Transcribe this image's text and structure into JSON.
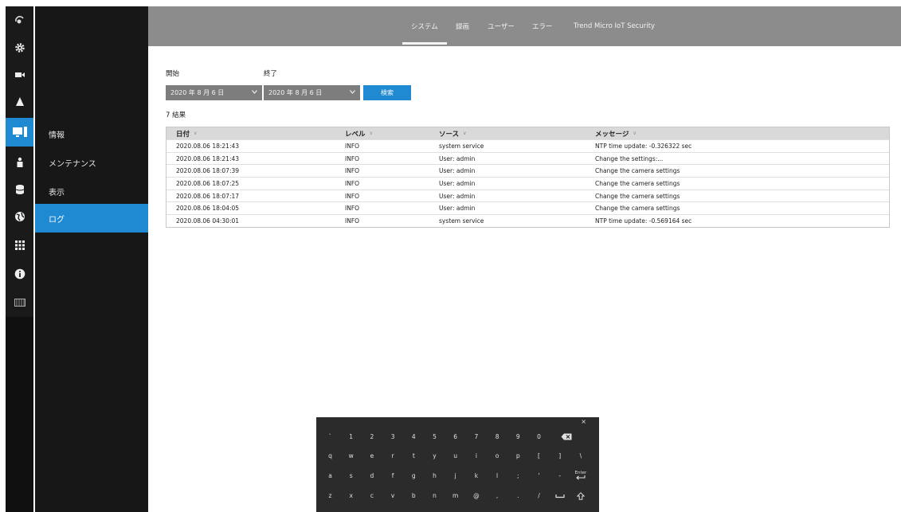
{
  "topbar": {
    "tabs": [
      {
        "label": "システム",
        "active": true
      },
      {
        "label": "録画",
        "active": false
      },
      {
        "label": "ユーザー",
        "active": false
      },
      {
        "label": "エラー",
        "active": false
      },
      {
        "label": "Trend Micro IoT Security",
        "active": false
      }
    ]
  },
  "sidebar": {
    "icons": [
      "camera-eye-icon",
      "gear-icon",
      "video-camera-icon",
      "bell-icon",
      "monitor-icon",
      "person-icon",
      "database-icon",
      "globe-icon",
      "grid-icon",
      "info-icon",
      "film-icon"
    ],
    "items": [
      {
        "label": "情報"
      },
      {
        "label": "メンテナンス"
      },
      {
        "label": "表示"
      },
      {
        "label": "ログ",
        "active": true
      }
    ]
  },
  "filter": {
    "start_label": "開始",
    "end_label": "終了",
    "start_date": "2020 年 8 月 6 日",
    "end_date": "2020 年 8 月 6 日",
    "search_label": "検索"
  },
  "results": "7 結果",
  "table": {
    "columns": [
      "日付",
      "レベル",
      "ソース",
      "メッセージ"
    ],
    "rows": [
      [
        "2020.08.06 18:21:43",
        "INFO",
        "system service",
        "NTP time update: -0.326322 sec"
      ],
      [
        "2020.08.06 18:21:43",
        "INFO",
        "User: admin",
        "Change the settings:..."
      ],
      [
        "2020.08.06 18:07:39",
        "INFO",
        "User: admin",
        "Change the camera settings"
      ],
      [
        "2020.08.06 18:07:25",
        "INFO",
        "User: admin",
        "Change the camera settings"
      ],
      [
        "2020.08.06 18:07:17",
        "INFO",
        "User: admin",
        "Change the camera settings"
      ],
      [
        "2020.08.06 18:04:05",
        "INFO",
        "User: admin",
        "Change the camera settings"
      ],
      [
        "2020.08.06 04:30:01",
        "INFO",
        "system service",
        "NTP time update: -0.569164 sec"
      ]
    ]
  },
  "keyboard": {
    "close": "×",
    "rows": [
      [
        "`",
        "1",
        "2",
        "3",
        "4",
        "5",
        "6",
        "7",
        "8",
        "9",
        "0"
      ],
      [
        "q",
        "w",
        "e",
        "r",
        "t",
        "y",
        "u",
        "i",
        "o",
        "p",
        "[",
        "]",
        "\\"
      ],
      [
        "a",
        "s",
        "d",
        "f",
        "g",
        "h",
        "j",
        "k",
        "l",
        ";",
        "'",
        "-"
      ],
      [
        "z",
        "x",
        "c",
        "v",
        "b",
        "n",
        "m",
        "@",
        ",",
        ".",
        "/"
      ]
    ],
    "enter_label": "Enter"
  },
  "colors": {
    "accent": "#1f8ad1",
    "topbar": "#8c8c8c",
    "sidebar": "#171717"
  }
}
